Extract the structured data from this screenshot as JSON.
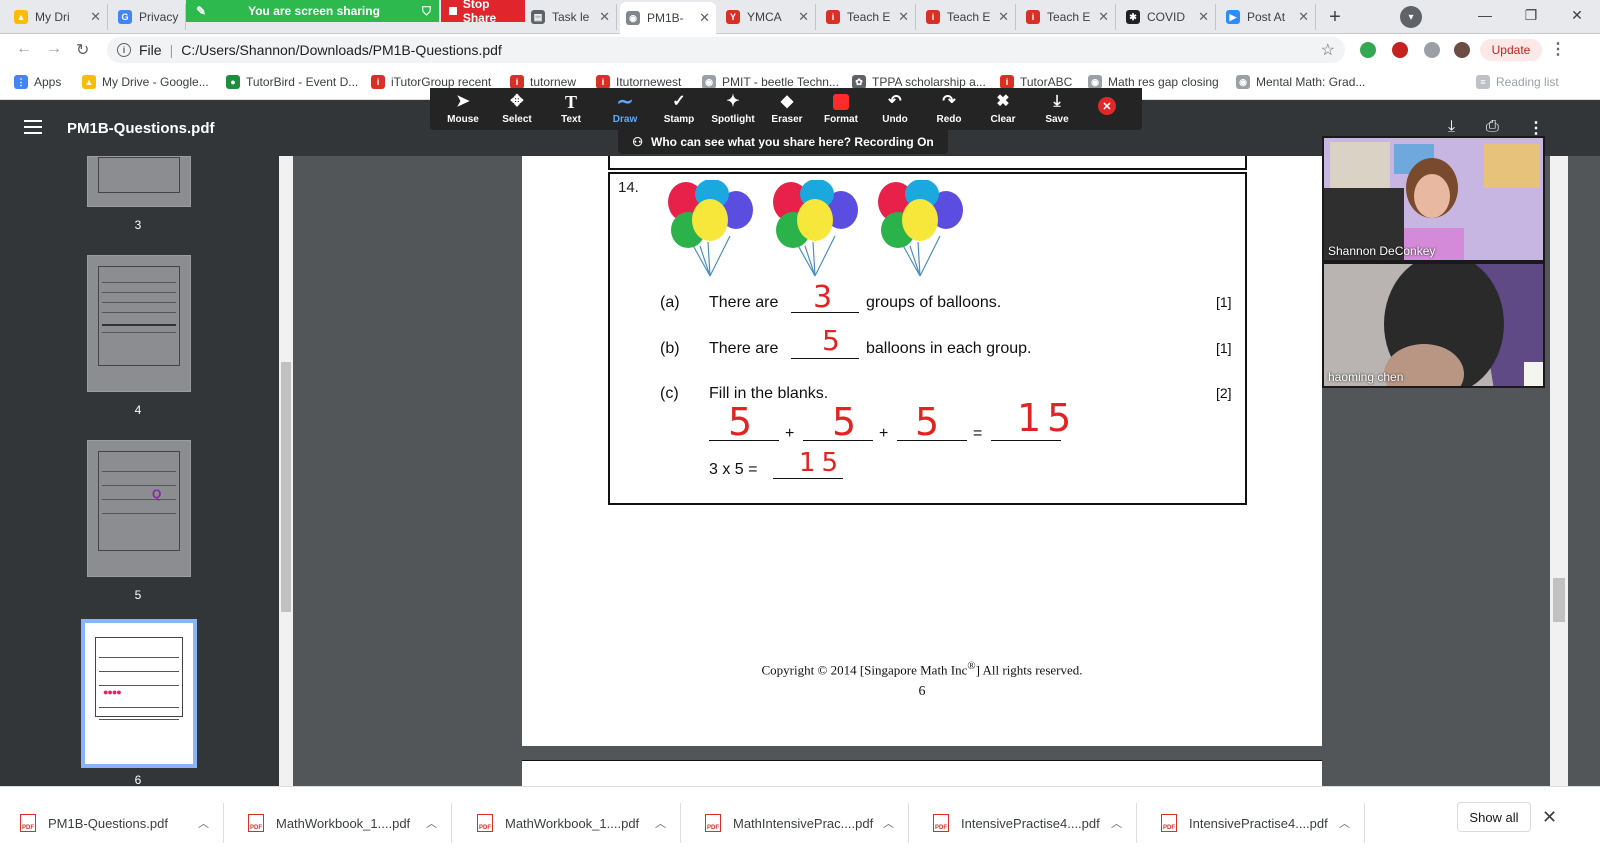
{
  "tabs": [
    {
      "title": "My Dri",
      "color": "#fbbc04"
    },
    {
      "title": "Privacy",
      "color": "#4285f4"
    },
    {
      "title": "Task le",
      "color": "#5f6368"
    },
    {
      "title": "PM1B-",
      "color": "#80868b"
    },
    {
      "title": "YMCA",
      "color": "#d93025"
    },
    {
      "title": "Teach E",
      "color": "#d93025"
    },
    {
      "title": "Teach E",
      "color": "#d93025"
    },
    {
      "title": "Teach E",
      "color": "#d93025"
    },
    {
      "title": "COVID",
      "color": "#202124"
    },
    {
      "title": "Post At",
      "color": "#2d8cff"
    }
  ],
  "screen_share": {
    "status": "You are screen sharing",
    "stop": "Stop Share"
  },
  "address_bar": {
    "scheme": "File",
    "path": "C:/Users/Shannon/Downloads/PM1B-Questions.pdf",
    "update": "Update"
  },
  "bookmarks": [
    "Apps",
    "My Drive - Google...",
    "TutorBird - Event D...",
    "iTutorGroup recent",
    "tutornew",
    "Itutornewest",
    "PMIT - beetle Techn...",
    "TPPA scholarship a...",
    "TutorABC",
    "Math res gap closing",
    "Mental Math: Grad...",
    "Reading list"
  ],
  "pdf_viewer": {
    "file_name": "PM1B-Questions.pdf"
  },
  "annotate_toolbar": {
    "tools": [
      {
        "label": "Mouse",
        "icon": "mouse-pointer-icon",
        "glyph": "➤"
      },
      {
        "label": "Select",
        "icon": "move-icon",
        "glyph": "✥"
      },
      {
        "label": "Text",
        "icon": "text-icon",
        "glyph": "T"
      },
      {
        "label": "Draw",
        "icon": "squiggle-icon",
        "glyph": "∼"
      },
      {
        "label": "Stamp",
        "icon": "check-icon",
        "glyph": "✓"
      },
      {
        "label": "Spotlight",
        "icon": "wand-icon",
        "glyph": "✦"
      },
      {
        "label": "Eraser",
        "icon": "eraser-icon",
        "glyph": "◆"
      },
      {
        "label": "Format",
        "icon": "color-swatch-icon",
        "glyph": "■"
      },
      {
        "label": "Undo",
        "icon": "undo-icon",
        "glyph": "↶"
      },
      {
        "label": "Redo",
        "icon": "redo-icon",
        "glyph": "↷"
      },
      {
        "label": "Clear",
        "icon": "trash-icon",
        "glyph": "🗑"
      },
      {
        "label": "Save",
        "icon": "save-icon",
        "glyph": "⤓"
      }
    ],
    "active_tool": "Draw",
    "recording_notice": "Who can see what you share here? Recording On"
  },
  "thumbnails": [
    "3",
    "4",
    "5",
    "6"
  ],
  "question": {
    "number": "14.",
    "a": {
      "letter": "(a)",
      "before": "There are",
      "after": "groups of balloons.",
      "mark": "[1]",
      "answer": "3"
    },
    "b": {
      "letter": "(b)",
      "before": "There are",
      "after": "balloons in each group.",
      "mark": "[1]",
      "answer": "5"
    },
    "c": {
      "letter": "(c)",
      "text": "Fill in the blanks.",
      "mark": "[2]",
      "plus": "+",
      "equals": "=",
      "answers": [
        "5",
        "5",
        "5",
        "15"
      ],
      "mult_expr": "3 x 5 =",
      "mult_answer": "15"
    }
  },
  "footer": {
    "copyright_prefix": "Copyright © 2014 [Singapore Math Inc",
    "registered": "®",
    "copyright_suffix": "] All rights reserved.",
    "page_number": "6"
  },
  "participants": [
    {
      "name": "Shannon DeConkey"
    },
    {
      "name": "haoming    chen"
    }
  ],
  "downloads": [
    "PM1B-Questions.pdf",
    "MathWorkbook_1....pdf",
    "MathWorkbook_1....pdf",
    "MathIntensivePrac....pdf",
    "IntensivePractise4....pdf",
    "IntensivePractise4....pdf"
  ],
  "downloads_show_all": "Show all",
  "colors": {
    "zoom_green": "#2db94d",
    "zoom_red": "#e0262c",
    "ink_red": "#e32222",
    "draw_active": "#5ea8ff"
  }
}
